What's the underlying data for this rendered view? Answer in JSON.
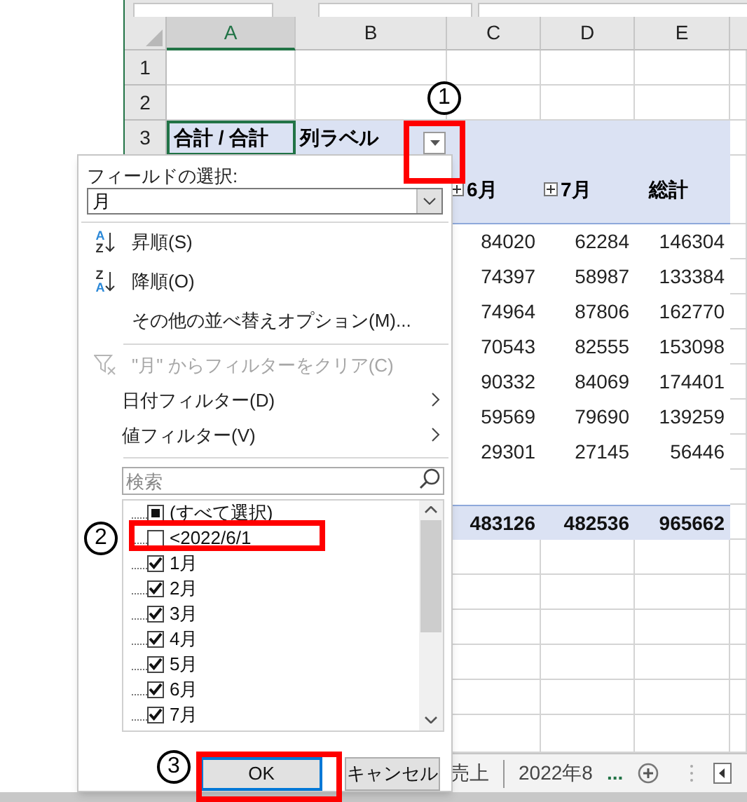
{
  "columns": [
    {
      "label": "A",
      "selected": true
    },
    {
      "label": "B",
      "selected": false
    },
    {
      "label": "C",
      "selected": false
    },
    {
      "label": "D",
      "selected": false
    },
    {
      "label": "E",
      "selected": false
    }
  ],
  "rows": [
    {
      "number": "1"
    },
    {
      "number": "2"
    },
    {
      "number": "3"
    }
  ],
  "pivot": {
    "corner": "合計 / 合計",
    "column_label": "列ラベル",
    "headers": [
      {
        "label": "6月",
        "expandable": true
      },
      {
        "label": "7月",
        "expandable": true
      },
      {
        "label": "総計",
        "expandable": false
      }
    ],
    "data": [
      [
        "84020",
        "62284",
        "146304"
      ],
      [
        "74397",
        "58987",
        "133384"
      ],
      [
        "74964",
        "87806",
        "162770"
      ],
      [
        "70543",
        "82555",
        "153098"
      ],
      [
        "90332",
        "84069",
        "174401"
      ],
      [
        "59569",
        "79690",
        "139259"
      ],
      [
        "29301",
        "27145",
        "56446"
      ]
    ],
    "totals": [
      "483126",
      "482536",
      "965662"
    ]
  },
  "sheet_tabs": [
    {
      "label": "売上"
    },
    {
      "label": "2022年8"
    }
  ],
  "more_tabs": "...",
  "dropdown": {
    "field_label": "フィールドの選択:",
    "field_value": "月",
    "menu": [
      {
        "kind": "sort",
        "icon_top": "A",
        "icon_bottom": "Z",
        "label": "昇順(S)",
        "disabled": false,
        "separator_before": false
      },
      {
        "kind": "sort",
        "icon_top": "Z",
        "icon_bottom": "A",
        "label": "降順(O)",
        "disabled": false,
        "separator_before": false
      },
      {
        "kind": "text",
        "label": "その他の並べ替えオプション(M)...",
        "disabled": false,
        "separator_before": false
      },
      {
        "kind": "clear_filter",
        "label": "\"月\" からフィルターをクリア(C)",
        "disabled": true,
        "separator_before": true
      },
      {
        "kind": "submenu",
        "label": "日付フィルター(D)",
        "disabled": false,
        "separator_before": false
      },
      {
        "kind": "submenu",
        "label": "値フィルター(V)",
        "disabled": false,
        "separator_before": false
      }
    ],
    "search": {
      "placeholder": "検索"
    },
    "options": [
      {
        "label": "(すべて選択)",
        "checked": false,
        "partial": true
      },
      {
        "label": "<2022/6/1",
        "checked": false
      },
      {
        "label": "1月",
        "checked": true
      },
      {
        "label": "2月",
        "checked": true
      },
      {
        "label": "3月",
        "checked": true
      },
      {
        "label": "4月",
        "checked": true
      },
      {
        "label": "5月",
        "checked": true
      },
      {
        "label": "6月",
        "checked": true
      },
      {
        "label": "7月",
        "checked": true
      }
    ],
    "buttons": [
      {
        "label": "OK",
        "default": true
      },
      {
        "label": "キャンセル",
        "default": false
      }
    ]
  },
  "annotations": [
    {
      "label": "1"
    },
    {
      "label": "2"
    },
    {
      "label": "3"
    }
  ]
}
